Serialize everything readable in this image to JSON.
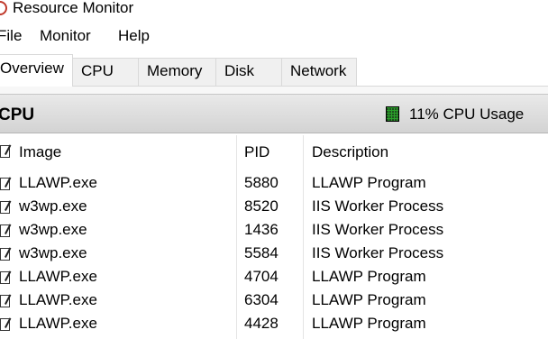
{
  "window": {
    "title": "Resource Monitor"
  },
  "menu": [
    {
      "label": "File"
    },
    {
      "label": "Monitor"
    },
    {
      "label": "Help"
    }
  ],
  "tabs": [
    {
      "label": "Overview",
      "active": true
    },
    {
      "label": "CPU",
      "active": false
    },
    {
      "label": "Memory",
      "active": false
    },
    {
      "label": "Disk",
      "active": false
    },
    {
      "label": "Network",
      "active": false
    }
  ],
  "cpu_section": {
    "title": "CPU",
    "usage_label": "11% CPU Usage",
    "usage_color": "#2aa02a"
  },
  "table": {
    "headers": {
      "image": "Image",
      "pid": "PID",
      "description": "Description"
    },
    "rows": [
      {
        "image": "LLAWP.exe",
        "pid": "5880",
        "description": "LLAWP Program",
        "checked": true
      },
      {
        "image": "w3wp.exe",
        "pid": "8520",
        "description": "IIS Worker Process",
        "checked": true
      },
      {
        "image": "w3wp.exe",
        "pid": "1436",
        "description": "IIS Worker Process",
        "checked": true
      },
      {
        "image": "w3wp.exe",
        "pid": "5584",
        "description": "IIS Worker Process",
        "checked": true
      },
      {
        "image": "LLAWP.exe",
        "pid": "4704",
        "description": "LLAWP Program",
        "checked": true
      },
      {
        "image": "LLAWP.exe",
        "pid": "6304",
        "description": "LLAWP Program",
        "checked": true
      },
      {
        "image": "LLAWP.exe",
        "pid": "4428",
        "description": "LLAWP Program",
        "checked": true
      }
    ]
  }
}
